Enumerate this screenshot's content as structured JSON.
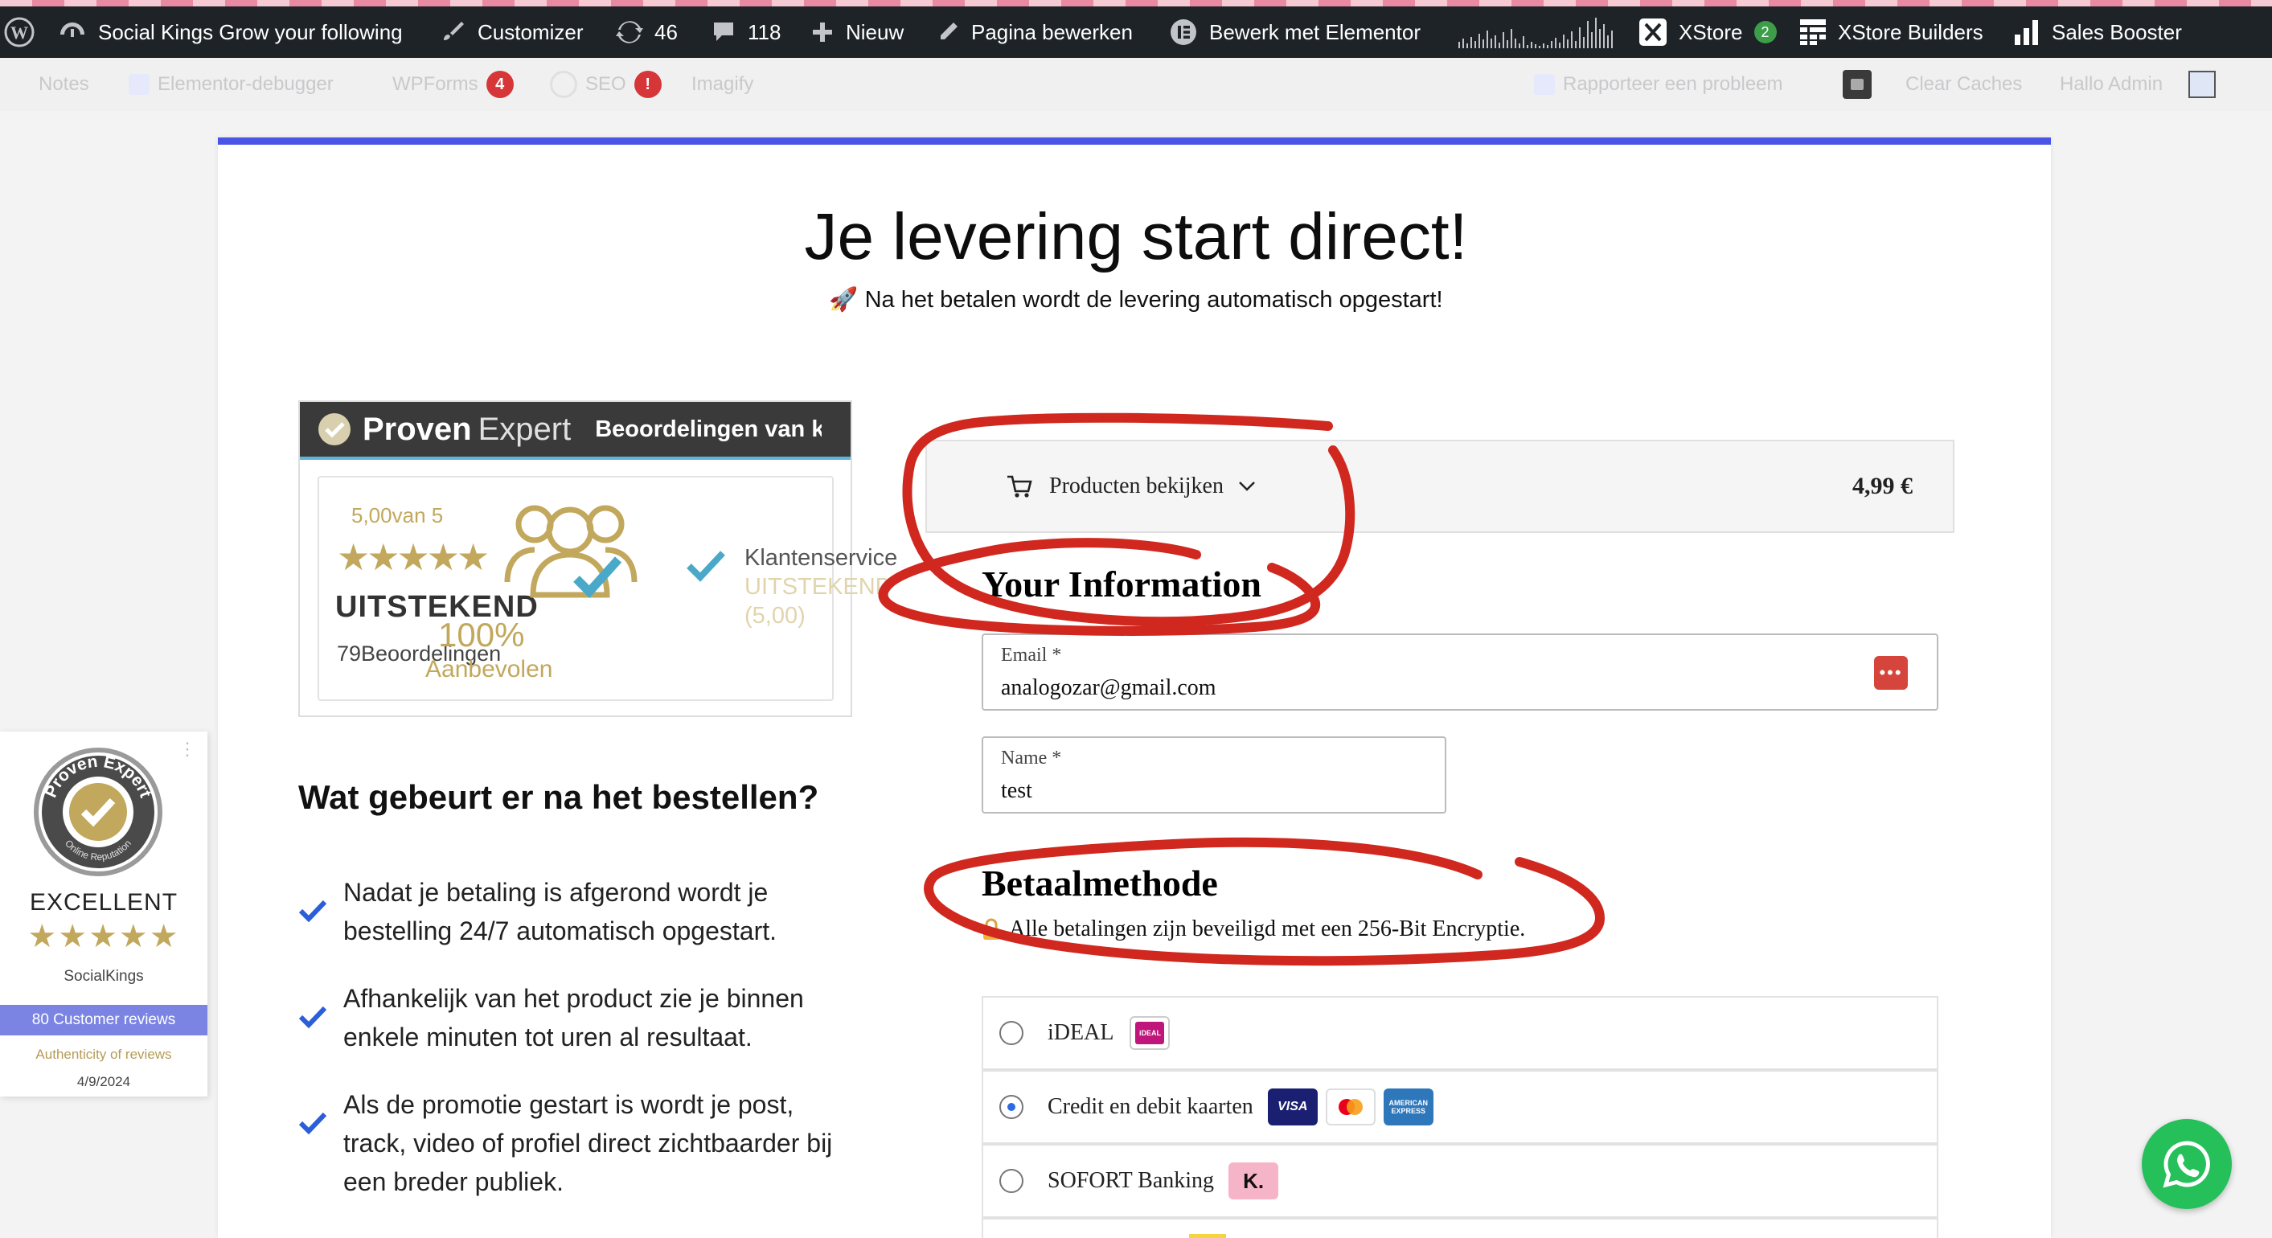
{
  "admin_bar": {
    "site_name": "Social Kings Grow your following",
    "customizer": "Customizer",
    "updates_count": "46",
    "comments_count": "118",
    "new_label": "Nieuw",
    "edit_page": "Pagina bewerken",
    "edit_elementor": "Bewerk met Elementor",
    "xstore": "XStore",
    "xstore_badge": "2",
    "xstore_builders": "XStore Builders",
    "sales_booster": "Sales Booster"
  },
  "sub_bar": {
    "notes": "Notes",
    "elementor_debugger": "Elementor-debugger",
    "wpforms": "WPForms",
    "wpforms_badge": "4",
    "seo": "SEO",
    "seo_badge": "!",
    "imagify": "Imagify",
    "report_problem": "Rapporteer een probleem",
    "clear_caches": "Clear Caches",
    "greeting": "Hallo Admin"
  },
  "page": {
    "title": "Je levering start direct!",
    "subtitle_icon": "🚀",
    "subtitle": "Na het betalen wordt de levering automatisch opgestart!"
  },
  "proven_expert": {
    "brand_bold": "Proven",
    "brand_light": "Expert",
    "header_text": "Beoordelingen van klanten",
    "rating_text": "5,00van 5",
    "stars": 5,
    "verdict": "UITSTEKEND",
    "reviews_count": "79Beoordelingen",
    "recommend_percent": "100%",
    "recommend_label": "Aanbevolen",
    "service_label": "Klantenservice",
    "service_verdict": "UITSTEKEND",
    "service_score": "(5,00)"
  },
  "steps_heading": "Wat gebeurt er na het bestellen?",
  "steps": [
    {
      "line1": "Nadat je betaling is afgerond wordt je",
      "line2": "bestelling 24/7 automatisch opgestart.",
      "line3": ""
    },
    {
      "line1": "Afhankelijk van het product zie je binnen",
      "line2": "enkele minuten tot uren al resultaat.",
      "line3": ""
    },
    {
      "line1": "Als de promotie gestart is wordt je post,",
      "line2": "track, video of profiel direct zichtbaarder bij",
      "line3": "een breder publiek."
    }
  ],
  "side_widget": {
    "seal_top": "Proven Expert",
    "seal_bottom": "Online Reputation",
    "rating": "EXCELLENT",
    "stars": 5,
    "company": "SocialKings",
    "reviews_button": "80 Customer reviews",
    "authenticity": "Authenticity of reviews",
    "date": "4/9/2024"
  },
  "checkout": {
    "products_toggle": "Producten bekijken",
    "price": "4,99 €",
    "info_heading": "Your Information",
    "email_label": "Email *",
    "email_value": "analogozar@gmail.com",
    "name_label": "Name *",
    "name_value": "test",
    "payment_heading": "Betaalmethode",
    "payment_secure": "Alle betalingen zijn beveiligd met een 256-Bit Encryptie.",
    "methods": [
      {
        "label": "iDEAL",
        "selected": false
      },
      {
        "label": "Credit en debit kaarten",
        "selected": true
      },
      {
        "label": "SOFORT Banking",
        "selected": false
      }
    ],
    "card_logos": [
      "VISA",
      "AMERICAN EXPRESS"
    ],
    "ideal_logo": "iDEAL",
    "klarna_logo": "K."
  },
  "colors": {
    "accent": "#4a55e8",
    "annotation": "#d0281f",
    "gold": "#c2a85c",
    "check": "#2b5fd9",
    "whatsapp": "#25c05a"
  }
}
